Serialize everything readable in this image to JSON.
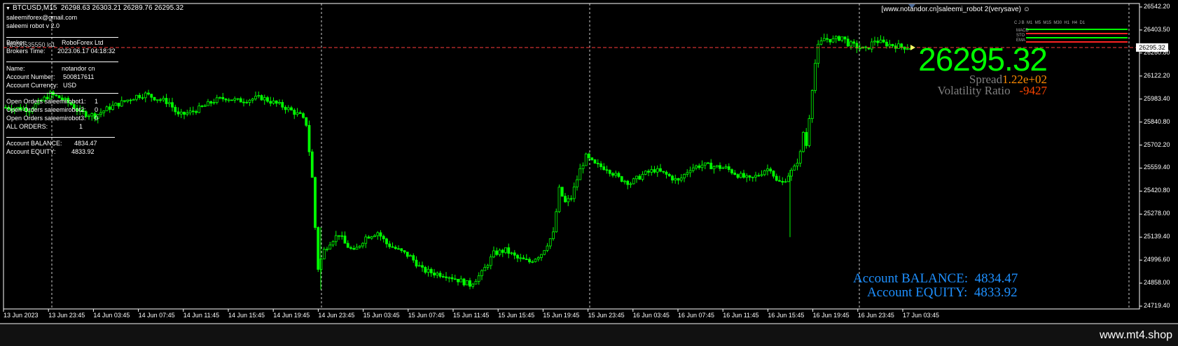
{
  "header": {
    "symbol": "BTCUSD,M15",
    "ohlc": "26298.63 26303.21 26289.76 26295.32",
    "email": "saleemiforex@gmail.com",
    "robot_version": "saleemi robot v 2.0",
    "robot_title": "[www.notandor.cn]saleemi_robot 2(verysave)"
  },
  "info_panel": {
    "broker_label": "Broker:",
    "broker_value": "RoboForex Ltd",
    "overlap_text": "NDD0535550 lo1",
    "broker_time_label": "Brokers Time:",
    "broker_time_value": "2023.06.17 04:18:32",
    "name_label": "Name:",
    "name_value": "notandor cn",
    "account_number_label": "Account Number:",
    "account_number_value": "500817611",
    "account_currency_label": "Account Currency:",
    "account_currency_value": "USD",
    "open_orders": [
      {
        "label": "Open Orders saleemirobot1:",
        "value": "1"
      },
      {
        "label": "Open Orders saleemirobot2:",
        "value": "0"
      },
      {
        "label": "Open Orders saleemirobot3:",
        "value": "0"
      }
    ],
    "all_orders_label": "ALL ORDERS:",
    "all_orders_value": "1",
    "balance_label": "Account BALANCE:",
    "balance_value": "4834.47",
    "equity_label": "Account EQUITY:",
    "equity_value": "4833.92"
  },
  "price_display": {
    "big_price": "26295.32",
    "spread_label": "Spread",
    "spread_value": "1.22e+02",
    "volatility_label": "Volatility Ratio",
    "volatility_value": "-9427"
  },
  "account_bottom": {
    "balance_label": "Account BALANCE:",
    "balance_value": "4834.47",
    "equity_label": "Account EQUITY:",
    "equity_value": "4833.92"
  },
  "indicator_panel": {
    "timeframes": [
      "C J B",
      "M1",
      "M5",
      "M15",
      "M30",
      "H1",
      "H4",
      "D1"
    ],
    "rows": [
      "MACD",
      "STO",
      "EMA"
    ]
  },
  "current_price_tag": "26295.32",
  "price_axis": [
    "26542.20",
    "26403.50",
    "26260.80",
    "26122.20",
    "25983.40",
    "25840.80",
    "25702.20",
    "25559.40",
    "25420.80",
    "25278.00",
    "25139.40",
    "24996.60",
    "24858.00",
    "24719.40"
  ],
  "time_axis": [
    "13 Jun 2023",
    "13 Jun 23:45",
    "14 Jun 03:45",
    "14 Jun 07:45",
    "14 Jun 11:45",
    "14 Jun 15:45",
    "14 Jun 19:45",
    "14 Jun 23:45",
    "15 Jun 03:45",
    "15 Jun 07:45",
    "15 Jun 11:45",
    "15 Jun 15:45",
    "15 Jun 19:45",
    "15 Jun 23:45",
    "16 Jun 03:45",
    "16 Jun 07:45",
    "16 Jun 11:45",
    "16 Jun 15:45",
    "16 Jun 19:45",
    "16 Jun 23:45",
    "17 Jun 03:45"
  ],
  "watermark": "www.mt4.shop",
  "colors": {
    "candle": "#00ff00",
    "grid": "#ffffff",
    "price_line": "#ff3b3b",
    "big_price": "#00ff00",
    "account_text": "#1e90ff"
  },
  "chart_data": {
    "type": "candlestick",
    "ylim": [
      24719.4,
      26542.2
    ],
    "close_path": [
      [
        0,
        25930
      ],
      [
        8,
        25920
      ],
      [
        12,
        25970
      ],
      [
        15,
        26010
      ],
      [
        18,
        25990
      ],
      [
        22,
        25950
      ],
      [
        25,
        25900
      ],
      [
        30,
        25880
      ],
      [
        35,
        25930
      ],
      [
        39,
        25960
      ],
      [
        44,
        26000
      ],
      [
        47,
        26010
      ],
      [
        50,
        25990
      ],
      [
        55,
        25960
      ],
      [
        58,
        25880
      ],
      [
        62,
        25900
      ],
      [
        66,
        25930
      ],
      [
        70,
        25970
      ],
      [
        74,
        25990
      ],
      [
        78,
        25970
      ],
      [
        82,
        25980
      ],
      [
        86,
        25990
      ],
      [
        90,
        25960
      ],
      [
        94,
        25930
      ],
      [
        97,
        25900
      ],
      [
        99,
        25880
      ],
      [
        101,
        25830
      ],
      [
        103,
        25500
      ],
      [
        104,
        25200
      ],
      [
        105,
        24950
      ],
      [
        107,
        25060
      ],
      [
        109,
        25110
      ],
      [
        112,
        25160
      ],
      [
        114,
        25100
      ],
      [
        117,
        25050
      ],
      [
        121,
        25140
      ],
      [
        125,
        25170
      ],
      [
        128,
        25100
      ],
      [
        132,
        25060
      ],
      [
        136,
        25020
      ],
      [
        140,
        24940
      ],
      [
        144,
        24920
      ],
      [
        148,
        24910
      ],
      [
        152,
        24880
      ],
      [
        156,
        24850
      ],
      [
        160,
        24920
      ],
      [
        164,
        25040
      ],
      [
        168,
        25060
      ],
      [
        172,
        25010
      ],
      [
        176,
        24990
      ],
      [
        180,
        25040
      ],
      [
        184,
        25160
      ],
      [
        186,
        25430
      ],
      [
        188,
        25350
      ],
      [
        190,
        25380
      ],
      [
        193,
        25550
      ],
      [
        195,
        25630
      ],
      [
        198,
        25580
      ],
      [
        202,
        25560
      ],
      [
        206,
        25500
      ],
      [
        210,
        25470
      ],
      [
        214,
        25520
      ],
      [
        218,
        25550
      ],
      [
        222,
        25520
      ],
      [
        226,
        25480
      ],
      [
        230,
        25560
      ],
      [
        234,
        25580
      ],
      [
        238,
        25570
      ],
      [
        242,
        25560
      ],
      [
        246,
        25520
      ],
      [
        250,
        25490
      ],
      [
        253,
        25520
      ],
      [
        255,
        25550
      ],
      [
        257,
        25560
      ],
      [
        259,
        25480
      ],
      [
        261,
        25470
      ],
      [
        263,
        25520
      ],
      [
        265,
        25560
      ],
      [
        267,
        25650
      ],
      [
        268,
        25780
      ],
      [
        269,
        25700
      ],
      [
        271,
        26050
      ],
      [
        272,
        26200
      ],
      [
        273,
        26300
      ],
      [
        275,
        26350
      ],
      [
        278,
        26340
      ],
      [
        281,
        26360
      ],
      [
        283,
        26320
      ],
      [
        286,
        26300
      ],
      [
        289,
        26280
      ],
      [
        292,
        26340
      ],
      [
        295,
        26320
      ],
      [
        298,
        26310
      ],
      [
        301,
        26300
      ],
      [
        304,
        26295.32
      ]
    ]
  }
}
